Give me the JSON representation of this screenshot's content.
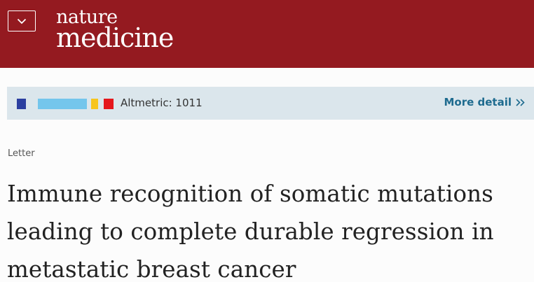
{
  "header": {
    "menu_icon": "chevron-down-icon",
    "logo_line1": "nature",
    "logo_line2": "medicine",
    "background_color": "#941a20"
  },
  "altmetric": {
    "label": "Altmetric: 1011",
    "more_detail_label": "More detail",
    "more_detail_icon": "double-chevron-right-icon",
    "donut_colors": [
      "#2b3fa0",
      "#74c6ec",
      "#f7c51e",
      "#e5171c"
    ]
  },
  "article": {
    "type": "Letter",
    "title": "Immune recognition of somatic mutations leading to complete durable regression in metastatic breast cancer"
  }
}
